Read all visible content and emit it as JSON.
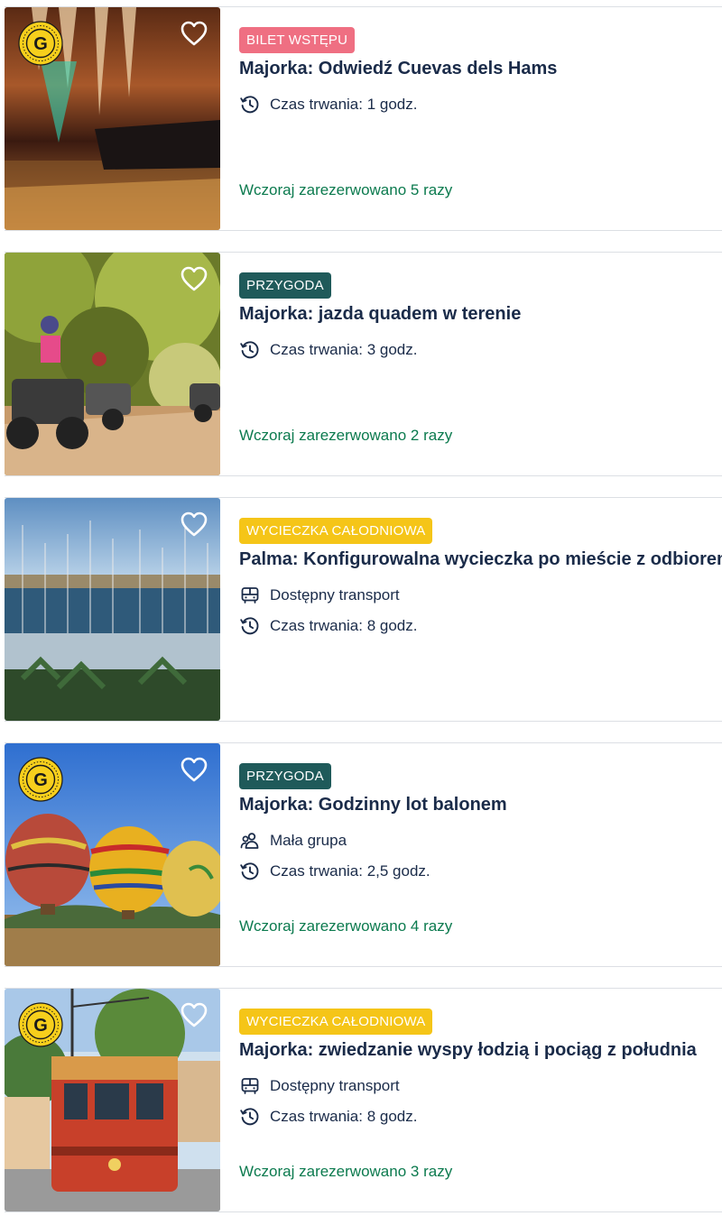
{
  "cards": [
    {
      "tag": "BILET WSTĘPU",
      "title": "Majorka: Odwiedź Cuevas dels Hams",
      "duration": "Czas trwania: 1 godz.",
      "booked": "Wczoraj zarezerwowano 5 razy"
    },
    {
      "tag": "PRZYGODA",
      "title": "Majorka: jazda quadem w terenie",
      "duration": "Czas trwania: 3 godz.",
      "booked": "Wczoraj zarezerwowano 2 razy"
    },
    {
      "tag": "WYCIECZKA CAŁODNIOWA",
      "title": "Palma: Konfigurowalna wycieczka po mieście z odbiorem",
      "transport": "Dostępny transport",
      "duration": "Czas trwania: 8 godz."
    },
    {
      "tag": "PRZYGODA",
      "title": "Majorka: Godzinny lot balonem",
      "group": "Mała grupa",
      "duration": "Czas trwania: 2,5 godz.",
      "booked": "Wczoraj zarezerwowano 4 razy"
    },
    {
      "tag": "WYCIECZKA CAŁODNIOWA",
      "title": "Majorka: zwiedzanie wyspy łodzią i pociąg z południa",
      "transport": "Dostępny transport",
      "duration": "Czas trwania: 8 godz.",
      "booked": "Wczoraj zarezerwowano 3 razy"
    }
  ],
  "badge_letter": "G",
  "icons": {
    "wishlist": "heart-icon",
    "duration": "clock-history-icon",
    "transport": "bus-icon",
    "group": "people-icon",
    "badge": "g-badge-icon"
  },
  "colors": {
    "tag_pink": "#ef6f82",
    "tag_teal": "#1f5a5a",
    "tag_yellow": "#f5c518",
    "booked_green": "#0b7a4e",
    "text_dark": "#1a2b49"
  }
}
